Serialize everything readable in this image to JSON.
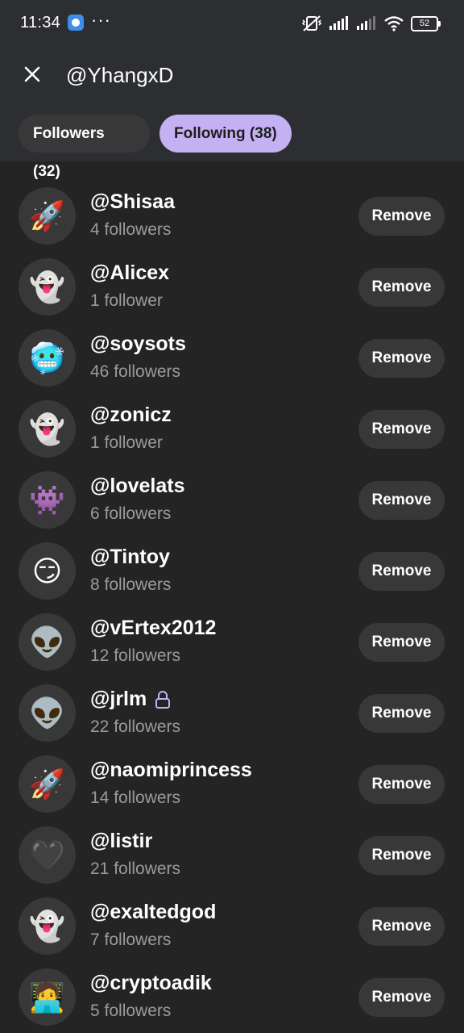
{
  "status_bar": {
    "time": "11:34",
    "more_dots": "···",
    "battery": "52"
  },
  "header": {
    "handle": "@YhangxD"
  },
  "tabs": [
    {
      "label": "Followers (32)",
      "active": false
    },
    {
      "label": "Following (38)",
      "active": true
    }
  ],
  "colors": {
    "active_tab": "#c4b1f3",
    "background": "#242424",
    "header_background": "#2d2e31",
    "pill_background": "#383838",
    "secondary_text": "#9b9b9b"
  },
  "users": [
    {
      "username": "@Shisaa",
      "followers": "4 followers",
      "avatar": "🚀",
      "locked": false,
      "button": "Remove"
    },
    {
      "username": "@Alicex",
      "followers": "1 follower",
      "avatar": "👻",
      "locked": false,
      "button": "Remove"
    },
    {
      "username": "@soysots",
      "followers": "46 followers",
      "avatar": "🥶",
      "locked": false,
      "button": "Remove"
    },
    {
      "username": "@zonicz",
      "followers": "1 follower",
      "avatar": "👻",
      "locked": false,
      "button": "Remove"
    },
    {
      "username": "@lovelats",
      "followers": "6 followers",
      "avatar": "👾",
      "locked": false,
      "button": "Remove"
    },
    {
      "username": "@Tintoy",
      "followers": "8 followers",
      "avatar": "😏",
      "locked": false,
      "button": "Remove"
    },
    {
      "username": "@vErtex2012",
      "followers": "12 followers",
      "avatar": "👽",
      "locked": false,
      "button": "Remove"
    },
    {
      "username": "@jrlm",
      "followers": "22 followers",
      "avatar": "👽",
      "locked": true,
      "button": "Remove"
    },
    {
      "username": "@naomiprincess",
      "followers": "14 followers",
      "avatar": "🚀",
      "locked": false,
      "button": "Remove"
    },
    {
      "username": "@listir",
      "followers": "21 followers",
      "avatar": "🖤",
      "locked": false,
      "button": "Remove"
    },
    {
      "username": "@exaltedgod",
      "followers": "7 followers",
      "avatar": "👻",
      "locked": false,
      "button": "Remove"
    },
    {
      "username": "@cryptoadik",
      "followers": "5 followers",
      "avatar": "🧑‍💻",
      "locked": false,
      "button": "Remove"
    }
  ]
}
